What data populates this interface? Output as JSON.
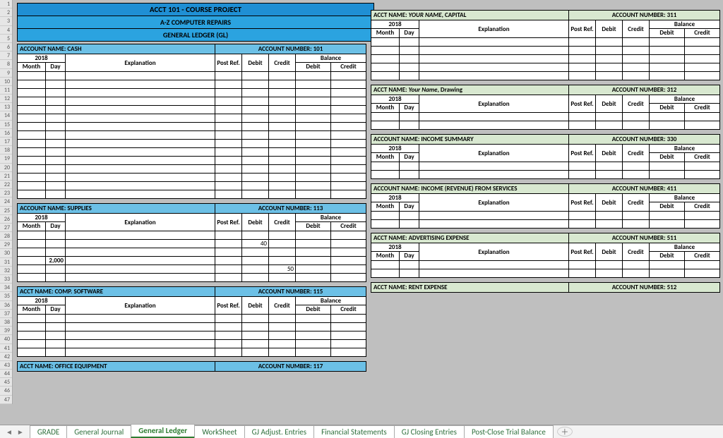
{
  "row_labels": [
    1,
    2,
    3,
    4,
    5,
    6,
    7,
    8,
    9,
    10,
    11,
    12,
    13,
    14,
    15,
    16,
    17,
    18,
    19,
    20,
    21,
    22,
    23,
    24,
    25,
    26,
    27,
    28,
    29,
    30,
    31,
    32,
    33,
    34,
    35,
    36,
    37,
    38,
    39,
    40,
    41,
    42,
    43,
    44,
    45,
    46,
    47
  ],
  "title": {
    "line1": "ACCT 101 - COURSE PROJECT",
    "line2": "A-Z COMPUTER REPAIRS",
    "line3": "GENERAL LEDGER (GL)"
  },
  "labels": {
    "year": "2018",
    "month": "Month",
    "day": "Day",
    "explanation": "Explanation",
    "post_ref": "Post Ref.",
    "debit": "Debit",
    "credit": "Credit",
    "balance": "Balance",
    "acct_name": "ACCOUNT NAME:",
    "acct_name2": "ACCT NAME:",
    "acct_num": "ACCOUNT NUMBER:"
  },
  "left": [
    {
      "name": "CASH",
      "num": "101",
      "rows": 15,
      "style": "blue",
      "label_style": "ACCOUNT NAME:"
    },
    {
      "name": "SUPPLIES",
      "num": "113",
      "rows": 6,
      "style": "blue",
      "label_style": "ACCOUNT NAME:",
      "data": {
        "1": {
          "debit": "40"
        },
        "3": {
          "day": "2,000"
        },
        "4": {
          "credit": "50"
        }
      }
    },
    {
      "name": "COMP. SOFTWARE",
      "num": "115",
      "rows": 5,
      "style": "blue",
      "label_style": "ACCT NAME:"
    },
    {
      "name": "OFFICE EQUIPMENT",
      "num": "117",
      "rows": 0,
      "style": "blue",
      "label_style": "ACCT NAME:"
    }
  ],
  "right": [
    {
      "name": "YOUR NAME , CAPITAL",
      "num": "311",
      "rows": 5,
      "style": "green",
      "label_style": "ACCT NAME:",
      "italic_name": true
    },
    {
      "name": "Your Name , Drawing",
      "num": "312",
      "rows": 2,
      "style": "green",
      "label_style": "ACCT NAME:",
      "italic_name": true
    },
    {
      "name": "INCOME SUMMARY",
      "num": "330",
      "rows": 2,
      "style": "green",
      "label_style": "ACCOUNT NAME:"
    },
    {
      "name": "INCOME (REVENUE) FROM SERVICES",
      "num": "411",
      "rows": 2,
      "style": "green",
      "label_style": "ACCOUNT NAME:"
    },
    {
      "name": "ADVERTISING EXPENSE",
      "num": "511",
      "rows": 2,
      "style": "green",
      "label_style": "ACCT NAME:"
    },
    {
      "name": "RENT EXPENSE",
      "num": "512",
      "rows": 0,
      "style": "green",
      "label_style": "ACCT NAME:"
    }
  ],
  "tabs": {
    "items": [
      "GRADE",
      "General Journal",
      "General Ledger",
      "WorkSheet",
      "GJ Adjust. Entries",
      "Financial Statements",
      "GJ Closing Entries",
      "Post-Close Trial Balance"
    ],
    "active": 2
  }
}
